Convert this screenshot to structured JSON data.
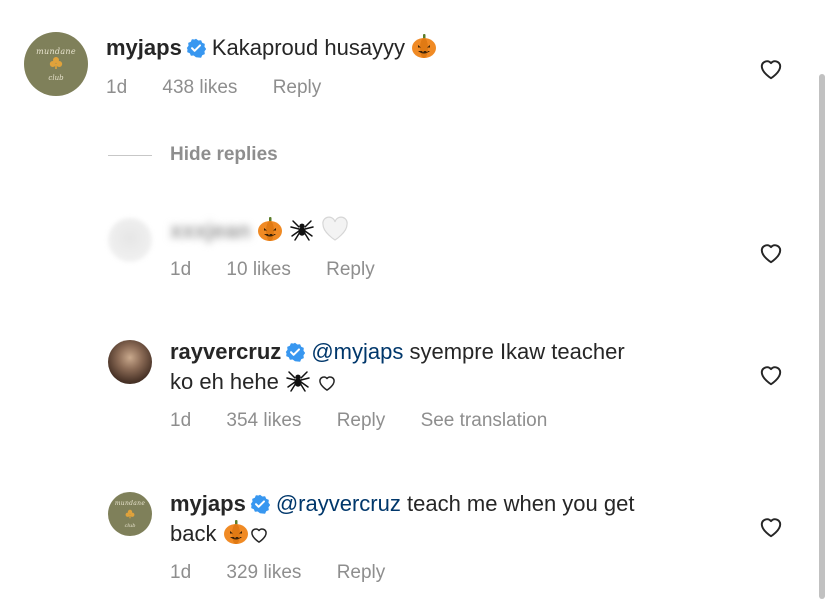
{
  "comments": [
    {
      "username": "myjaps",
      "verified": true,
      "text": "Kakaproud husayyy",
      "time": "1d",
      "likes": "438 likes",
      "reply": "Reply",
      "avatar_brand_top": "mundane",
      "avatar_brand_bottom": "club",
      "avatar_icon": "club-icon"
    }
  ],
  "hide_replies": "Hide replies",
  "replies": [
    {
      "username": "xxxjean",
      "username_blurred": true,
      "time": "1d",
      "likes": "10 likes",
      "reply": "Reply"
    },
    {
      "username": "rayvercruz",
      "verified": true,
      "mention": "@myjaps",
      "text_line1": "syempre Ikaw teacher",
      "text_line2": "ko eh hehe",
      "time": "1d",
      "likes": "354 likes",
      "reply": "Reply",
      "translate": "See translation"
    },
    {
      "username": "myjaps",
      "verified": true,
      "mention": "@rayvercruz",
      "text_line1": "teach me when you get",
      "text_line2": "back",
      "time": "1d",
      "likes": "329 likes",
      "reply": "Reply",
      "avatar_brand_top": "mundane",
      "avatar_brand_bottom": "club"
    }
  ],
  "colors": {
    "text": "#262626",
    "secondary": "#8e8e8e",
    "mention": "#00376b",
    "verified": "#3897f0",
    "avatar_brand": "#7f805a"
  }
}
